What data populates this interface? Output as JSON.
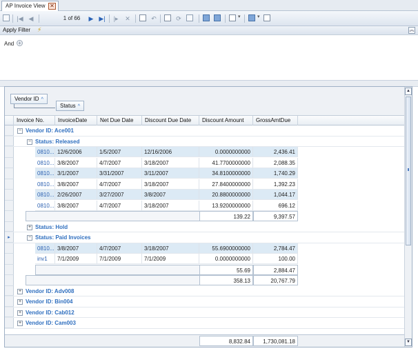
{
  "tab": {
    "title": "AP Invoice View",
    "close_glyph": "✕"
  },
  "toolbar": {
    "page_label": "1 of 66"
  },
  "filter": {
    "title": "Apply Filter",
    "operator": "And",
    "add_glyph": "+"
  },
  "grouping": {
    "chips": [
      {
        "label": "Vendor ID",
        "sort": "^"
      },
      {
        "label": "Status",
        "sort": "^"
      }
    ]
  },
  "columns": [
    "Invoice No.",
    "InvoiceDate",
    "Net Due Date",
    "Discount Due Date",
    "Discount Amount",
    "GrossAmtDue"
  ],
  "groups": {
    "vendor1": {
      "label": "Vendor ID: Ace001"
    },
    "status_released": {
      "label": "Status: Released"
    },
    "status_hold": {
      "label": "Status: Hold"
    },
    "status_paid": {
      "label": "Status: Paid Invoices"
    },
    "vendor2": {
      "label": "Vendor ID: Adv008"
    },
    "vendor3": {
      "label": "Vendor ID: Bin004"
    },
    "vendor4": {
      "label": "Vendor ID: Cab012"
    },
    "vendor5": {
      "label": "Vendor ID: Cam003"
    }
  },
  "released_rows": [
    {
      "invoice": "0810...",
      "date": "12/6/2006",
      "net_due": "1/5/2007",
      "disc_due": "12/16/2006",
      "disc_amt": "0.0000000000",
      "gross": "2,436.41"
    },
    {
      "invoice": "0810...",
      "date": "3/8/2007",
      "net_due": "4/7/2007",
      "disc_due": "3/18/2007",
      "disc_amt": "41.7700000000",
      "gross": "2,088.35"
    },
    {
      "invoice": "0810...",
      "date": "3/1/2007",
      "net_due": "3/31/2007",
      "disc_due": "3/11/2007",
      "disc_amt": "34.8100000000",
      "gross": "1,740.29"
    },
    {
      "invoice": "0810...",
      "date": "3/8/2007",
      "net_due": "4/7/2007",
      "disc_due": "3/18/2007",
      "disc_amt": "27.8400000000",
      "gross": "1,392.23"
    },
    {
      "invoice": "0810...",
      "date": "2/26/2007",
      "net_due": "3/27/2007",
      "disc_due": "3/8/2007",
      "disc_amt": "20.8800000000",
      "gross": "1,044.17"
    },
    {
      "invoice": "0810...",
      "date": "3/8/2007",
      "net_due": "4/7/2007",
      "disc_due": "3/18/2007",
      "disc_amt": "13.9200000000",
      "gross": "696.12"
    }
  ],
  "released_summary": {
    "disc_amt": "139.22",
    "gross": "9,397.57"
  },
  "paid_rows": [
    {
      "invoice": "0810...",
      "date": "3/8/2007",
      "net_due": "4/7/2007",
      "disc_due": "3/18/2007",
      "disc_amt": "55.6900000000",
      "gross": "2,784.47"
    },
    {
      "invoice": "inv1",
      "date": "7/1/2009",
      "net_due": "7/1/2009",
      "disc_due": "7/1/2009",
      "disc_amt": "0.0000000000",
      "gross": "100.00"
    }
  ],
  "paid_summary": {
    "disc_amt": "55.69",
    "gross": "2,884.47"
  },
  "vendor1_summary": {
    "disc_amt": "358.13",
    "gross": "20,767.79"
  },
  "grand_total": {
    "disc_amt": "8,832.84",
    "gross": "1,730,081.18"
  },
  "icons": {
    "expand": "+",
    "collapse": "−",
    "row_indicator": "▸"
  }
}
